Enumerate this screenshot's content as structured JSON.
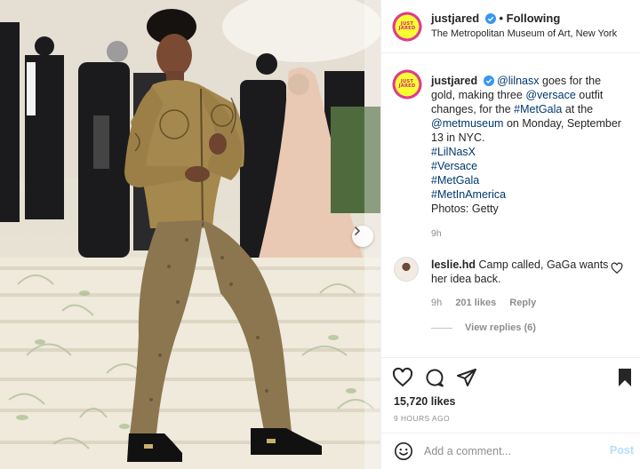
{
  "post": {
    "username": "justjared",
    "follow_separator": "•",
    "follow_status": "Following",
    "location": "The Metropolitan Museum of Art, New York",
    "avatar_text": [
      "JUST",
      "JARED"
    ]
  },
  "caption": {
    "username": "justjared",
    "mention_1": "@lilnasx",
    "text_1": "goes for the gold, making three",
    "mention_2": "@versace",
    "text_2": "outfit changes, for the",
    "hashtag_1": "#MetGala",
    "text_3": "at the",
    "mention_3": "@metmuseum",
    "text_4": "on Monday, September 13 in NYC.",
    "hashtags": [
      "#LilNasX",
      "#Versace",
      "#MetGala",
      "#MetInAmerica"
    ],
    "credit": "Photos: Getty",
    "time": "9h"
  },
  "comment": {
    "username": "leslie.hd",
    "text": "Camp called, GaGa wants her idea back.",
    "time": "9h",
    "likes": "201 likes",
    "reply": "Reply",
    "view_replies": "View replies (6)"
  },
  "stats": {
    "likes": "15,720 likes",
    "time_ago": "9 HOURS AGO"
  },
  "composer": {
    "placeholder": "Add a comment...",
    "post_label": "Post"
  },
  "icons": {
    "verified": "verified-badge-icon",
    "next": "chevron-right-icon",
    "like": "heart-icon",
    "comment": "speech-bubble-icon",
    "share": "paper-plane-icon",
    "save": "bookmark-icon",
    "emoji": "smiley-icon"
  },
  "colors": {
    "verified_blue": "#3897f0",
    "link_blue": "#00376b",
    "post_disabled": "#b2dffc",
    "secondary_text": "#8e8e8e"
  }
}
